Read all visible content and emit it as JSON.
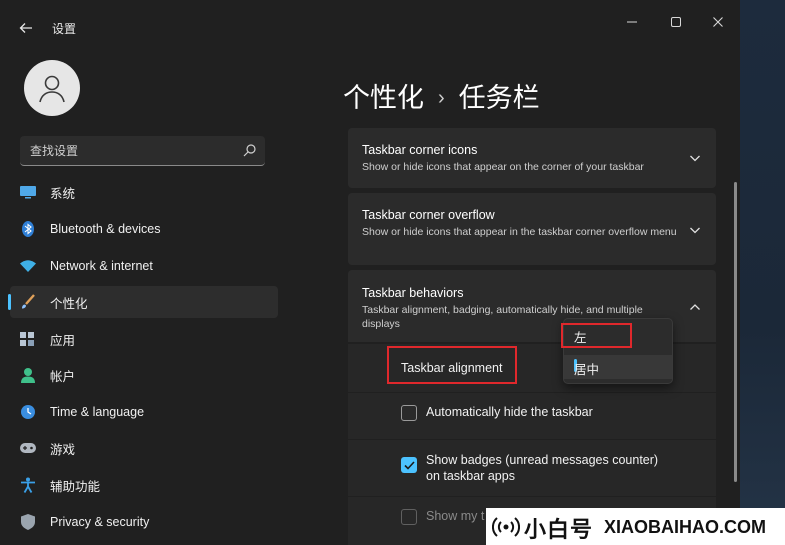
{
  "titlebar": {
    "back_icon": "back-arrow-icon",
    "app_title": "设置",
    "controls": [
      "minimize-icon",
      "maximize-icon",
      "close-icon"
    ]
  },
  "search": {
    "placeholder": "查找设置",
    "icon": "search-icon"
  },
  "sidebar": {
    "items": [
      {
        "label": "系统",
        "icon": "monitor-icon",
        "active": false
      },
      {
        "label": "Bluetooth & devices",
        "icon": "bluetooth-icon",
        "active": false
      },
      {
        "label": "Network & internet",
        "icon": "wifi-icon",
        "active": false
      },
      {
        "label": "个性化",
        "icon": "brush-icon",
        "active": true
      },
      {
        "label": "应用",
        "icon": "apps-icon",
        "active": false
      },
      {
        "label": "帐户",
        "icon": "person-icon",
        "active": false
      },
      {
        "label": "Time & language",
        "icon": "globe-clock-icon",
        "active": false
      },
      {
        "label": "游戏",
        "icon": "gamepad-icon",
        "active": false
      },
      {
        "label": "辅助功能",
        "icon": "accessibility-icon",
        "active": false
      },
      {
        "label": "Privacy & security",
        "icon": "shield-icon",
        "active": false
      }
    ]
  },
  "breadcrumb": {
    "parent": "个性化",
    "separator": "›",
    "current": "任务栏"
  },
  "cards": {
    "corner_icons": {
      "title": "Taskbar corner icons",
      "desc": "Show or hide icons that appear on the corner of your taskbar"
    },
    "corner_overflow": {
      "title": "Taskbar corner overflow",
      "desc": "Show or hide icons that appear in the taskbar corner overflow menu"
    },
    "behaviors": {
      "title": "Taskbar behaviors",
      "desc": "Taskbar alignment, badging, automatically hide, and multiple displays"
    }
  },
  "behaviors": {
    "alignment_label": "Taskbar alignment",
    "alignment_options": [
      "左",
      "居中"
    ],
    "alignment_selected": "居中",
    "auto_hide": {
      "label": "Automatically hide the taskbar",
      "checked": false
    },
    "badges": {
      "label_line1": "Show badges (unread messages counter)",
      "label_line2": "on taskbar apps",
      "checked": true
    },
    "show_my": {
      "label": "Show my t",
      "checked": false
    }
  },
  "watermark": {
    "cn": "小白号",
    "en": "XIAOBAIHAO.COM"
  },
  "colors": {
    "accent": "#4cc2ff",
    "highlight": "#e0282c",
    "window_bg": "#202020",
    "card_bg": "#2b2b2b"
  }
}
